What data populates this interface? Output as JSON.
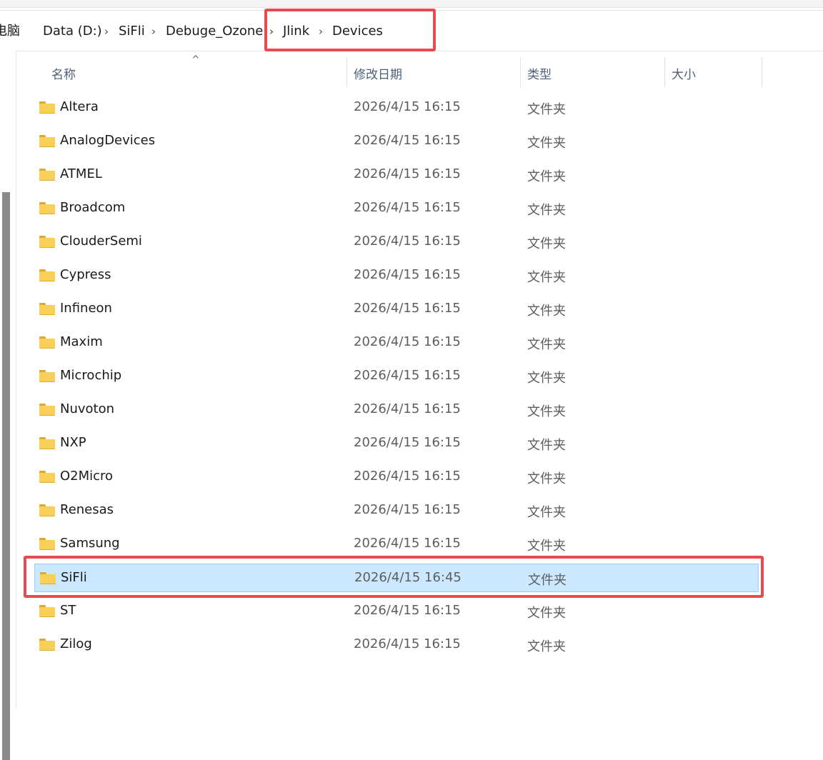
{
  "breadcrumb": [
    {
      "label": "电脑"
    },
    {
      "label": "Data (D:)"
    },
    {
      "label": "SiFli"
    },
    {
      "label": "Debuge_Ozone"
    },
    {
      "label": "Jlink"
    },
    {
      "label": "Devices"
    }
  ],
  "breadcrumb_separator": "›",
  "sort_indicator": "^",
  "columns": {
    "name": "名称",
    "date": "修改日期",
    "type": "类型",
    "size": "大小"
  },
  "files": [
    {
      "name": "Altera",
      "date": "2026/4/15 16:15",
      "type": "文件夹",
      "selected": false
    },
    {
      "name": "AnalogDevices",
      "date": "2026/4/15 16:15",
      "type": "文件夹",
      "selected": false
    },
    {
      "name": "ATMEL",
      "date": "2026/4/15 16:15",
      "type": "文件夹",
      "selected": false
    },
    {
      "name": "Broadcom",
      "date": "2026/4/15 16:15",
      "type": "文件夹",
      "selected": false
    },
    {
      "name": "ClouderSemi",
      "date": "2026/4/15 16:15",
      "type": "文件夹",
      "selected": false
    },
    {
      "name": "Cypress",
      "date": "2026/4/15 16:15",
      "type": "文件夹",
      "selected": false
    },
    {
      "name": "Infineon",
      "date": "2026/4/15 16:15",
      "type": "文件夹",
      "selected": false
    },
    {
      "name": "Maxim",
      "date": "2026/4/15 16:15",
      "type": "文件夹",
      "selected": false
    },
    {
      "name": "Microchip",
      "date": "2026/4/15 16:15",
      "type": "文件夹",
      "selected": false
    },
    {
      "name": "Nuvoton",
      "date": "2026/4/15 16:15",
      "type": "文件夹",
      "selected": false
    },
    {
      "name": "NXP",
      "date": "2026/4/15 16:15",
      "type": "文件夹",
      "selected": false
    },
    {
      "name": "O2Micro",
      "date": "2026/4/15 16:15",
      "type": "文件夹",
      "selected": false
    },
    {
      "name": "Renesas",
      "date": "2026/4/15 16:15",
      "type": "文件夹",
      "selected": false
    },
    {
      "name": "Samsung",
      "date": "2026/4/15 16:15",
      "type": "文件夹",
      "selected": false
    },
    {
      "name": "SiFli",
      "date": "2026/4/15 16:45",
      "type": "文件夹",
      "selected": true
    },
    {
      "name": "ST",
      "date": "2026/4/15 16:15",
      "type": "文件夹",
      "selected": false
    },
    {
      "name": "Zilog",
      "date": "2026/4/15 16:15",
      "type": "文件夹",
      "selected": false
    }
  ],
  "colors": {
    "highlight_box": "#e94a4f",
    "selected_row": "#cce8ff",
    "folder": "#f8cf57"
  },
  "icons": {
    "folder": "folder-icon",
    "separator": "chevron-right-icon"
  }
}
